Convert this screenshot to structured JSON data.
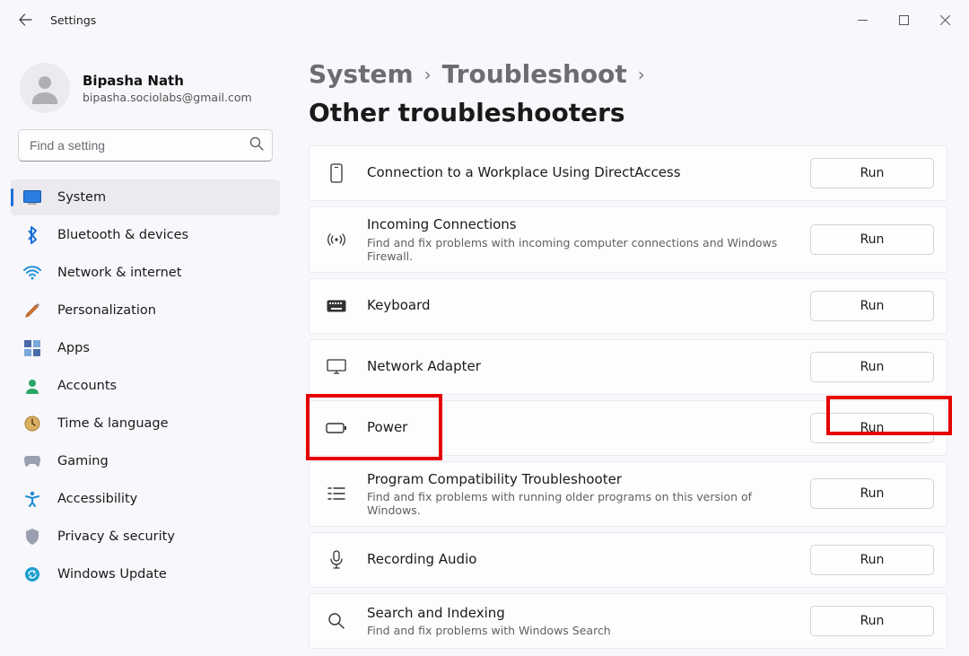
{
  "window": {
    "title": "Settings"
  },
  "profile": {
    "name": "Bipasha Nath",
    "email": "bipasha.sociolabs@gmail.com"
  },
  "search": {
    "placeholder": "Find a setting"
  },
  "sidebar": {
    "items": [
      {
        "label": "System"
      },
      {
        "label": "Bluetooth & devices"
      },
      {
        "label": "Network & internet"
      },
      {
        "label": "Personalization"
      },
      {
        "label": "Apps"
      },
      {
        "label": "Accounts"
      },
      {
        "label": "Time & language"
      },
      {
        "label": "Gaming"
      },
      {
        "label": "Accessibility"
      },
      {
        "label": "Privacy & security"
      },
      {
        "label": "Windows Update"
      }
    ]
  },
  "breadcrumb": {
    "a": "System",
    "b": "Troubleshoot",
    "c": "Other troubleshooters"
  },
  "buttons": {
    "run": "Run"
  },
  "troubleshooters": [
    {
      "title": "Connection to a Workplace Using DirectAccess",
      "desc": ""
    },
    {
      "title": "Incoming Connections",
      "desc": "Find and fix problems with incoming computer connections and Windows Firewall."
    },
    {
      "title": "Keyboard",
      "desc": ""
    },
    {
      "title": "Network Adapter",
      "desc": ""
    },
    {
      "title": "Power",
      "desc": ""
    },
    {
      "title": "Program Compatibility Troubleshooter",
      "desc": "Find and fix problems with running older programs on this version of Windows."
    },
    {
      "title": "Recording Audio",
      "desc": ""
    },
    {
      "title": "Search and Indexing",
      "desc": "Find and fix problems with Windows Search"
    }
  ]
}
